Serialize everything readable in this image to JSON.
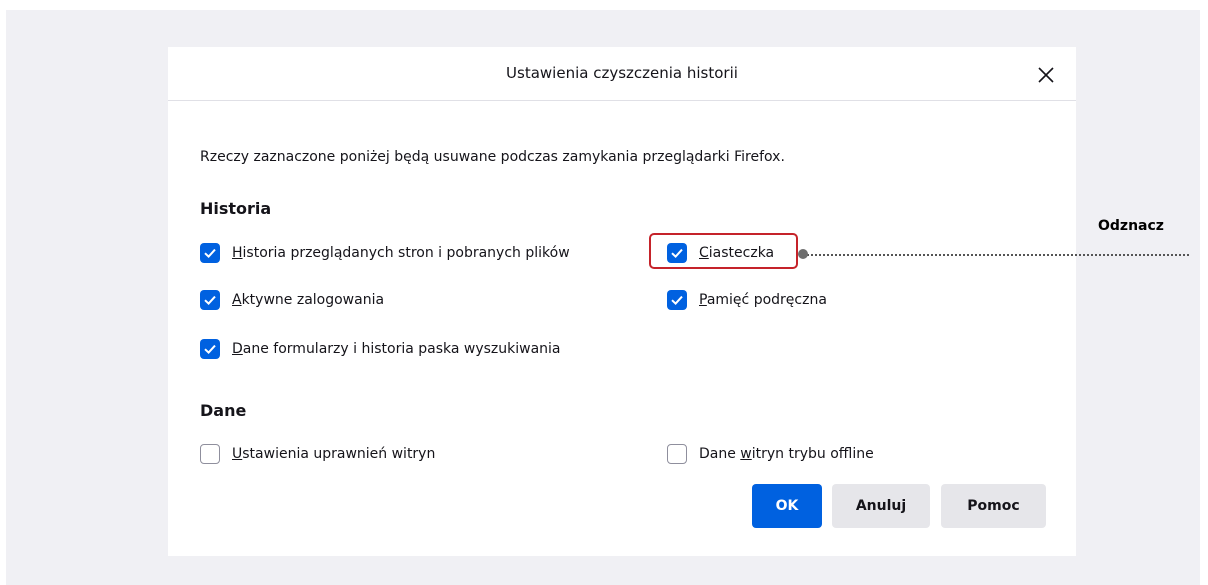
{
  "dialog": {
    "title": "Ustawienia czyszczenia historii",
    "close_icon": "close-icon",
    "description": "Rzeczy zaznaczone poniżej będą usuwane podczas zamykania przeglądarki Firefox."
  },
  "sections": {
    "history": {
      "title": "Historia",
      "options": [
        {
          "label_u": "H",
          "label_rest": "istoria przeglądanych stron i pobranych plików",
          "checked": true
        },
        {
          "label_u": "C",
          "label_rest": "iasteczka",
          "checked": true
        },
        {
          "label_u": "A",
          "label_rest": "ktywne zalogowania",
          "checked": true
        },
        {
          "label_u": "P",
          "label_rest": "amięć podręczna",
          "checked": true
        },
        {
          "label_u": "D",
          "label_rest": "ane formularzy i historia paska wyszukiwania",
          "checked": true
        }
      ]
    },
    "data": {
      "title": "Dane",
      "options": [
        {
          "label_u": "U",
          "label_rest": "stawienia uprawnień witryn",
          "checked": false
        },
        {
          "label_pre": "Dane ",
          "label_u": "w",
          "label_rest": "itryn trybu offline",
          "checked": false
        }
      ]
    }
  },
  "buttons": {
    "ok": "OK",
    "cancel": "Anuluj",
    "help": "Pomoc"
  },
  "annotation": {
    "label": "Odznacz",
    "highlight_color": "#c5232a"
  },
  "colors": {
    "accent": "#0061e0",
    "backdrop": "#f0f0f4"
  }
}
